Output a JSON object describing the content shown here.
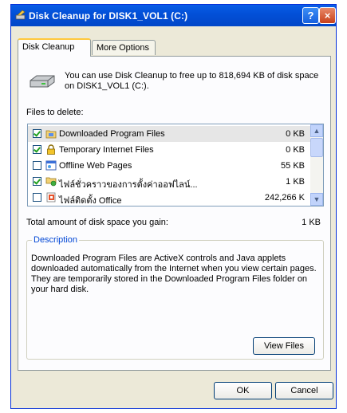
{
  "window": {
    "title": "Disk Cleanup for DISK1_VOL1 (C:)",
    "help_label": "?",
    "close_label": "×"
  },
  "tabs": [
    {
      "label": "Disk Cleanup",
      "active": true
    },
    {
      "label": "More Options",
      "active": false
    }
  ],
  "intro_text": "You can use Disk Cleanup to free up to 818,694 KB of disk space on DISK1_VOL1 (C:).",
  "files_label": "Files to delete:",
  "files": [
    {
      "name": "Downloaded Program Files",
      "size": "0 KB",
      "checked": true,
      "selected": true,
      "icon": "folder-icon"
    },
    {
      "name": "Temporary Internet Files",
      "size": "0 KB",
      "checked": true,
      "selected": false,
      "icon": "lock-icon"
    },
    {
      "name": "Offline Web Pages",
      "size": "55 KB",
      "checked": false,
      "selected": false,
      "icon": "webpage-icon"
    },
    {
      "name": "ไฟล์ชั่วคราวของการตั้งค่าออฟไลน์...",
      "size": "1 KB",
      "checked": true,
      "selected": false,
      "icon": "network-folder-icon"
    },
    {
      "name": "ไฟล์ติดตั้ง Office",
      "size": "242,266 K",
      "checked": false,
      "selected": false,
      "icon": "office-icon"
    }
  ],
  "total_label": "Total amount of disk space you gain:",
  "total_value": "1 KB",
  "description": {
    "title": "Description",
    "text": "Downloaded Program Files are ActiveX controls and Java applets downloaded automatically from the Internet when you view certain pages. They are temporarily stored in the Downloaded Program Files folder on your hard disk."
  },
  "buttons": {
    "view_files": "View Files",
    "ok": "OK",
    "cancel": "Cancel"
  }
}
